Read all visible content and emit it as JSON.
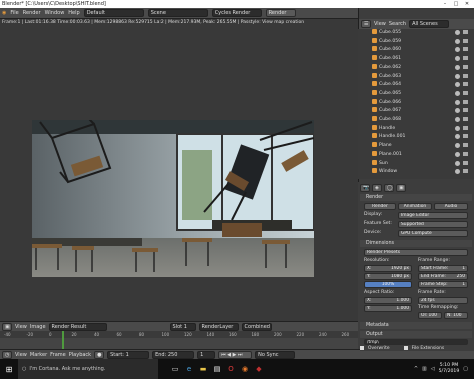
{
  "window": {
    "title": "Blender* [C:\\Users\\C\\Desktop\\SHIT.blend]"
  },
  "menubar": {
    "items": [
      "File",
      "Render",
      "Window",
      "Help"
    ],
    "layout": "Default",
    "scene": "Scene",
    "engine": "Cycles Render",
    "render_button": "Render",
    "version": "v2.79 | Verts:1,231,384 | Faces:1,231,384 | Tris:2,462,768 | Objects:0/98"
  },
  "viewport": {
    "info": "Frame:1 | Last:01:16.38 Time:00:03.63 | Mem:1298863 Re:529715 La:2 | Mem:217.93M, Peak: 265.55M | Passtyle: View map creation"
  },
  "image_editor_header": {
    "menus": [
      "View",
      "Image"
    ],
    "image": "Render Result",
    "slot": "Slot 1",
    "layer": "RenderLayer",
    "pass": "Combined"
  },
  "timeline": {
    "ruler_ticks": [
      "-40",
      "-20",
      "0",
      "20",
      "40",
      "60",
      "80",
      "100",
      "120",
      "140",
      "160",
      "180",
      "200",
      "220",
      "240",
      "260"
    ],
    "menus": [
      "View",
      "Marker",
      "Frame",
      "Playback"
    ],
    "start_label": "Start:",
    "start": "1",
    "end_label": "End:",
    "end": "250",
    "current": "1",
    "sync": "No Sync"
  },
  "outliner": {
    "menus": [
      "View",
      "Search"
    ],
    "filter": "All Scenes",
    "items": [
      "Cube.055",
      "Cube.059",
      "Cube.060",
      "Cube.061",
      "Cube.062",
      "Cube.063",
      "Cube.064",
      "Cube.065",
      "Cube.066",
      "Cube.067",
      "Cube.068",
      "Handle",
      "Handle.001",
      "Plane",
      "Plane.001",
      "Sun",
      "Window"
    ]
  },
  "properties": {
    "tabs": [
      "Render",
      "Animation",
      "Audio"
    ],
    "section_render": "Render",
    "display_label": "Display:",
    "display_value": "Image Editor",
    "feature_set_label": "Feature Set:",
    "feature_set_value": "Supported",
    "device_label": "Device:",
    "device_value": "GPU Compute",
    "section_dimensions": "Dimensions",
    "presets": "Render Presets",
    "resolution_label": "Resolution:",
    "res_x": "X:",
    "res_x_value": "1920 px",
    "res_y": "Y:",
    "res_y_value": "1080 px",
    "res_pct": "100%",
    "frame_range_label": "Frame Range:",
    "start_frame": "Start Frame:",
    "start_frame_value": "1",
    "end_frame": "End Frame:",
    "end_frame_value": "250",
    "frame_step": "Frame Step:",
    "frame_step_value": "1",
    "aspect_label": "Aspect Ratio:",
    "aspect_x": "X:",
    "aspect_x_value": "1.000",
    "aspect_y": "Y:",
    "aspect_y_value": "1.000",
    "frame_rate_label": "Frame Rate:",
    "frame_rate_value": "24 fps",
    "time_remap_label": "Time Remapping:",
    "time_remap_old": "Ol: 100",
    "time_remap_new": "N: 100",
    "section_metadata": "Metadata",
    "section_output": "Output",
    "output_path": "/tmp\\",
    "overwrite": "Overwrite",
    "file_ext": "File Extensions"
  },
  "taskbar": {
    "search": "I'm Cortana. Ask me anything.",
    "time": "5:10 PM",
    "date": "5/7/2019"
  }
}
